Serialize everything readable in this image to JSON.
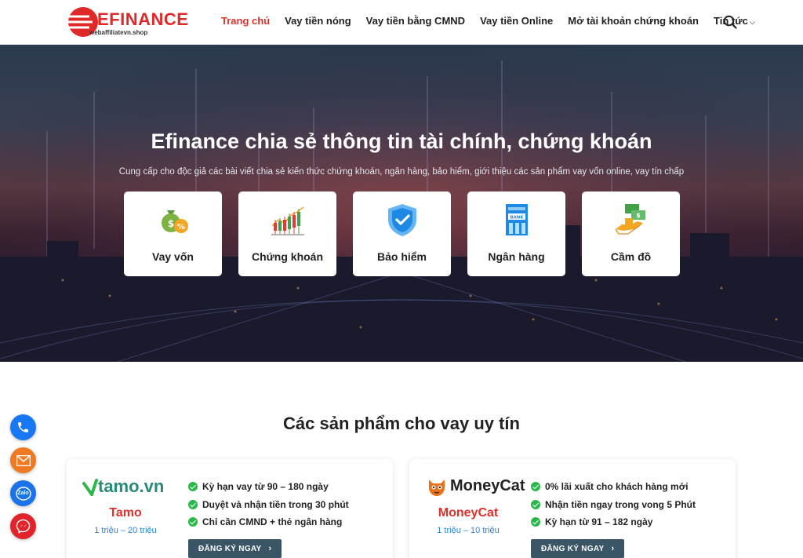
{
  "header": {
    "logo_text": "EFINANCE",
    "logo_sub": "webaffiliatevn.shop",
    "nav": [
      {
        "label": "Trang chủ"
      },
      {
        "label": "Vay tiền nóng"
      },
      {
        "label": "Vay tiền bằng CMND"
      },
      {
        "label": "Vay tiền Online"
      },
      {
        "label": "Mở tài khoản chứng khoán"
      },
      {
        "label": "Tin tức"
      }
    ],
    "accent_color": "#e0302a"
  },
  "hero": {
    "title": "Efinance chia sẻ thông tin tài chính, chứng khoán",
    "subtitle": "Cung cấp cho độc giả các bài viết chia sẻ kiến thức chứng khoán, ngân hàng, bảo hiểm, giới thiệu các sản phẩm vay vốn online, vay tín chấp",
    "cards": [
      {
        "label": "Vay vốn",
        "icon": "money-bag-icon"
      },
      {
        "label": "Chứng khoán",
        "icon": "candlestick-chart-icon"
      },
      {
        "label": "Bảo hiểm",
        "icon": "shield-check-icon"
      },
      {
        "label": "Ngân hàng",
        "icon": "bank-icon"
      },
      {
        "label": "Cầm đồ",
        "icon": "hand-money-icon"
      }
    ]
  },
  "section": {
    "title": "Các sản phẩm cho vay uy tín"
  },
  "products": [
    {
      "logo_text": "tamo.vn",
      "name": "Tamo",
      "range": "1 triệu – 20 triệu",
      "features": [
        "Kỳ hạn vay từ 90 – 180 ngày",
        "Duyệt và nhận tiền trong 30 phút",
        "Chỉ cần CMND + thẻ ngân hàng"
      ],
      "button": "ĐĂNG KÝ NGAY"
    },
    {
      "logo_text": "MoneyCat",
      "name": "MoneyCat",
      "range": "1 triệu – 10 triệu",
      "features": [
        "0% lãi xuất cho khách hàng mới",
        "Nhận tiền ngay trong vong 5 Phút",
        "Kỳ hạn từ 91 – 182 ngày"
      ],
      "button": "ĐĂNG KÝ NGAY"
    }
  ],
  "floating": [
    {
      "icon": "phone-icon",
      "color": "#1877f2"
    },
    {
      "icon": "email-icon",
      "color": "#f07a22"
    },
    {
      "icon": "zalo-icon",
      "label": "Zalo",
      "color": "#1a73e8"
    },
    {
      "icon": "messenger-icon",
      "color": "#e0242a"
    }
  ]
}
